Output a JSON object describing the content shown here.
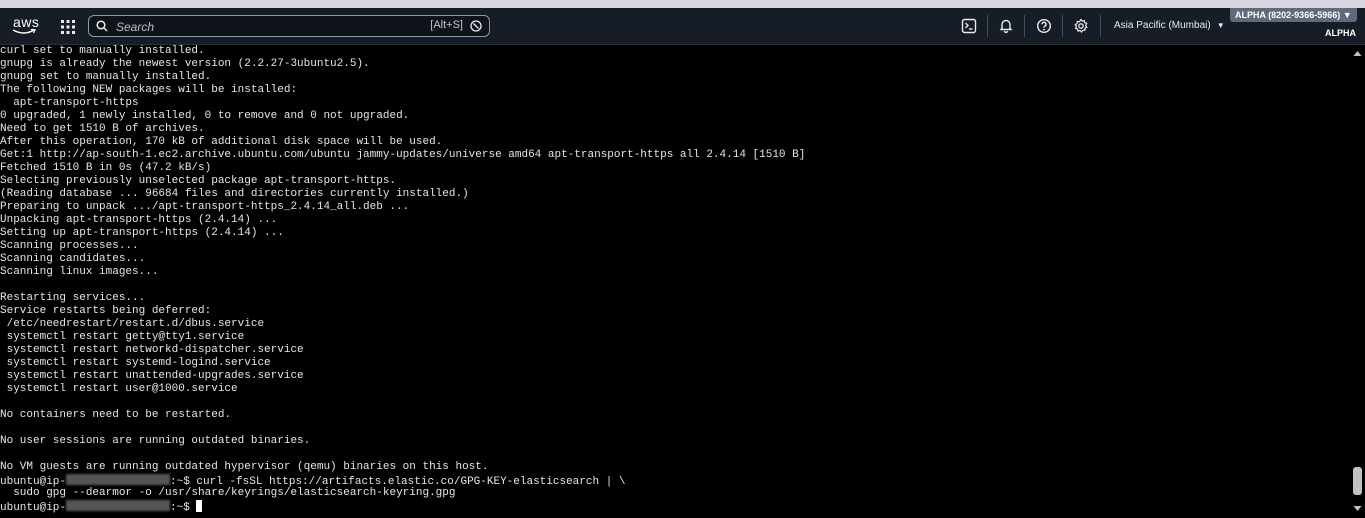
{
  "nav": {
    "logo_text": "aws",
    "search_placeholder": "Search",
    "search_shortcut": "[Alt+S]",
    "region_label": "Asia Pacific (Mumbai)",
    "region_caret": "▼",
    "account_badge": "ALPHA (8202-9366-5966) ▼",
    "account_label": "ALPHA",
    "icons": [
      "cloudshell-icon",
      "bell-icon",
      "help-icon",
      "gear-icon"
    ]
  },
  "terminal": {
    "output": "curl set to manually installed.\ngnupg is already the newest version (2.2.27-3ubuntu2.5).\ngnupg set to manually installed.\nThe following NEW packages will be installed:\n  apt-transport-https\n0 upgraded, 1 newly installed, 0 to remove and 0 not upgraded.\nNeed to get 1510 B of archives.\nAfter this operation, 170 kB of additional disk space will be used.\nGet:1 http://ap-south-1.ec2.archive.ubuntu.com/ubuntu jammy-updates/universe amd64 apt-transport-https all 2.4.14 [1510 B]\nFetched 1510 B in 0s (47.2 kB/s)\nSelecting previously unselected package apt-transport-https.\n(Reading database ... 96684 files and directories currently installed.)\nPreparing to unpack .../apt-transport-https_2.4.14_all.deb ...\nUnpacking apt-transport-https (2.4.14) ...\nSetting up apt-transport-https (2.4.14) ...\nScanning processes...\nScanning candidates...\nScanning linux images...\n\nRestarting services...\nService restarts being deferred:\n /etc/needrestart/restart.d/dbus.service\n systemctl restart getty@tty1.service\n systemctl restart networkd-dispatcher.service\n systemctl restart systemd-logind.service\n systemctl restart unattended-upgrades.service\n systemctl restart user@1000.service\n\nNo containers need to be restarted.\n\nNo user sessions are running outdated binaries.\n\nNo VM guests are running outdated hypervisor (qemu) binaries on this host.",
    "prompt_user": "ubuntu@ip-",
    "prompt_suffix": ":~$ ",
    "command_line1": "curl -fsSL https://artifacts.elastic.co/GPG-KEY-elasticsearch | \\",
    "command_line2": "  sudo gpg --dearmor -o /usr/share/keyrings/elasticsearch-keyring.gpg",
    "current_input": ""
  },
  "colors": {
    "nav_bg": "#161d26",
    "terminal_bg": "#000000",
    "terminal_fg": "#e6e6e6"
  }
}
